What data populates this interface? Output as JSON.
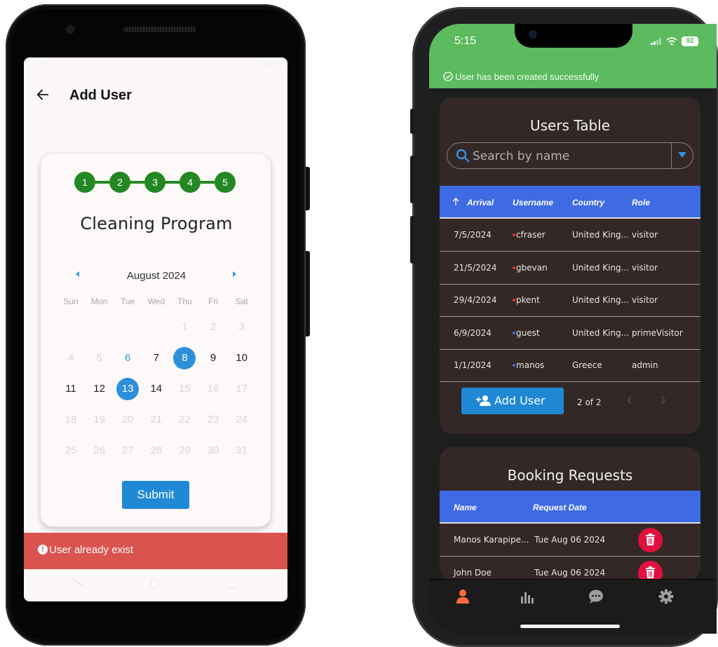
{
  "android": {
    "statusbar": {
      "time": "5:13",
      "battery": "100%"
    },
    "appbar": {
      "title": "Add User"
    },
    "stepper": {
      "steps": [
        "1",
        "2",
        "3",
        "4",
        "5"
      ]
    },
    "card_title": "Cleaning Program",
    "calendar": {
      "month": "August 2024",
      "weekdays": [
        "Sun",
        "Mon",
        "Tue",
        "Wed",
        "Thu",
        "Fri",
        "Sat"
      ],
      "weeks": [
        [
          {
            "d": ""
          },
          {
            "d": ""
          },
          {
            "d": ""
          },
          {
            "d": ""
          },
          {
            "d": "1",
            "s": "disabled"
          },
          {
            "d": "2",
            "s": "disabled"
          },
          {
            "d": "3",
            "s": "disabled"
          }
        ],
        [
          {
            "d": "4",
            "s": "disabled"
          },
          {
            "d": "5",
            "s": "disabled"
          },
          {
            "d": "6",
            "s": "today"
          },
          {
            "d": "7",
            "s": "normal"
          },
          {
            "d": "8",
            "s": "sel"
          },
          {
            "d": "9",
            "s": "normal"
          },
          {
            "d": "10",
            "s": "normal"
          }
        ],
        [
          {
            "d": "11",
            "s": "normal"
          },
          {
            "d": "12",
            "s": "normal"
          },
          {
            "d": "13",
            "s": "sel"
          },
          {
            "d": "14",
            "s": "normal"
          },
          {
            "d": "15",
            "s": "disabled"
          },
          {
            "d": "16",
            "s": "disabled"
          },
          {
            "d": "17",
            "s": "disabled"
          }
        ],
        [
          {
            "d": "18",
            "s": "disabled"
          },
          {
            "d": "19",
            "s": "disabled"
          },
          {
            "d": "20",
            "s": "disabled"
          },
          {
            "d": "21",
            "s": "disabled"
          },
          {
            "d": "22",
            "s": "disabled"
          },
          {
            "d": "23",
            "s": "disabled"
          },
          {
            "d": "24",
            "s": "disabled"
          }
        ],
        [
          {
            "d": "25",
            "s": "disabled"
          },
          {
            "d": "26",
            "s": "disabled"
          },
          {
            "d": "27",
            "s": "disabled"
          },
          {
            "d": "28",
            "s": "disabled"
          },
          {
            "d": "29",
            "s": "disabled"
          },
          {
            "d": "30",
            "s": "disabled"
          },
          {
            "d": "31",
            "s": "disabled"
          }
        ]
      ]
    },
    "submit_label": "Submit",
    "snackbar": {
      "message": "User already exist",
      "icon": "exclamation-circle-icon",
      "color": "#d9534f"
    },
    "colors": {
      "step": "#238823",
      "accent": "#2d8fd9"
    }
  },
  "iphone": {
    "statusbar": {
      "time": "5:15",
      "battery": "92"
    },
    "banner": {
      "message": "User has been created successfully",
      "color": "#5cba5f"
    },
    "users_table": {
      "title": "Users Table",
      "search_placeholder": "Search by name",
      "columns": [
        "Arrival",
        "Username",
        "Country",
        "Role"
      ],
      "rows": [
        {
          "arrival": "7/5/2024",
          "username": "cfraser",
          "dot": "#e53935",
          "country": "United King...",
          "role": "visitor"
        },
        {
          "arrival": "21/5/2024",
          "username": "gbevan",
          "dot": "#e53935",
          "country": "United King...",
          "role": "visitor"
        },
        {
          "arrival": "29/4/2024",
          "username": "pkent",
          "dot": "#e53935",
          "country": "United King...",
          "role": "visitor"
        },
        {
          "arrival": "6/9/2024",
          "username": "guest",
          "dot": "#3f6fe0",
          "country": "United King...",
          "role": "primeVisitor"
        },
        {
          "arrival": "1/1/2024",
          "username": "manos",
          "dot": "#3f6fe0",
          "country": "Greece",
          "role": "admin"
        }
      ],
      "add_user_label": "Add User",
      "page_info": "2 of 2"
    },
    "booking_requests": {
      "title": "Booking Requests",
      "columns": [
        "Name",
        "Request Date"
      ],
      "rows": [
        {
          "name": "Manos Karapipe...",
          "date": "Tue Aug 06 2024"
        },
        {
          "name": "John Doe",
          "date": "Tue Aug 06 2024"
        }
      ]
    },
    "tabs": [
      "person-icon",
      "bar-chart-icon",
      "chat-icon",
      "settings-icon"
    ],
    "colors": {
      "header": "#3e6be3",
      "panel": "#332826",
      "delete": "#e0113f",
      "active_tab": "#ff6a3d"
    }
  }
}
